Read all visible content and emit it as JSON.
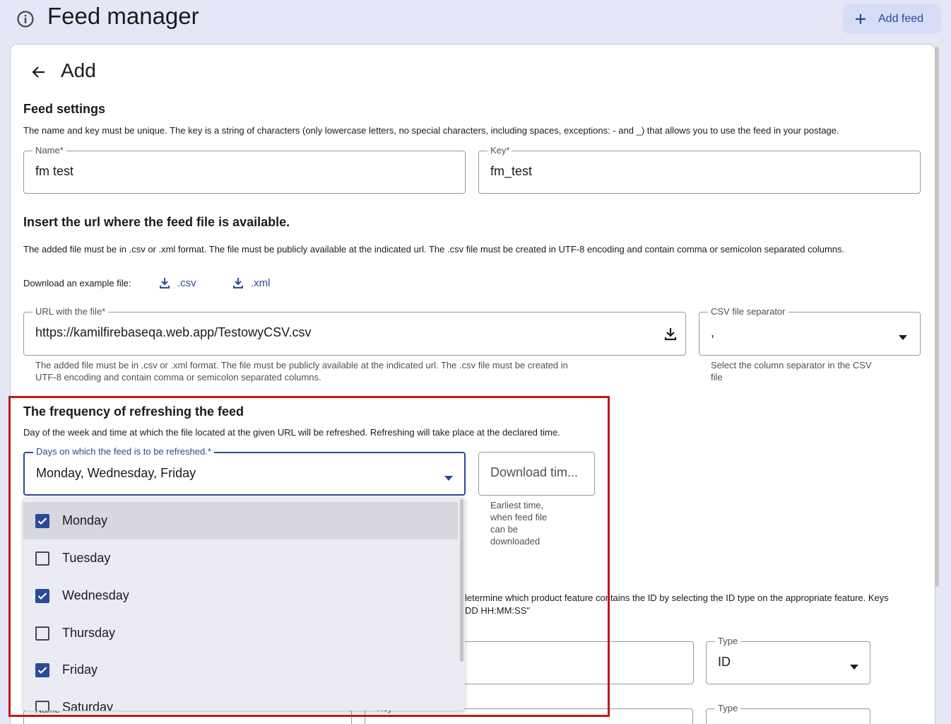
{
  "header": {
    "title": "Feed manager",
    "add_feed_label": "Add feed"
  },
  "card": {
    "title": "Add"
  },
  "feed_settings": {
    "title": "Feed settings",
    "description": "The name and key must be unique. The key is a string of characters (only lowercase letters, no special characters, including spaces, exceptions: - and _) that allows you to use the feed in your postage.",
    "name": {
      "label": "Name",
      "value": "fm test"
    },
    "key": {
      "label": "Key",
      "value": "fm_test"
    }
  },
  "url_section": {
    "title": "Insert the url where the feed file is available.",
    "description": "The added file must be in .csv or .xml format. The file must be publicly available at the indicated url. The .csv file must be created in UTF-8 encoding and contain comma or semicolon separated columns.",
    "example_label": "Download an example file:",
    "example_csv": ".csv",
    "example_xml": ".xml",
    "url_field": {
      "label": "URL with the file",
      "value": "https://kamilfirebaseqa.web.app/TestowyCSV.csv",
      "helper_line1": "The added file must be in .csv or .xml format. The file must be publicly available at the indicated url. The .csv file must be created in",
      "helper_line2": "UTF-8 encoding and contain comma or semicolon separated columns."
    },
    "separator_field": {
      "label": "CSV file separator",
      "value": ",",
      "helper_line1": "Select the column separator in the CSV",
      "helper_line2": "file"
    }
  },
  "frequency": {
    "title": "The frequency of refreshing the feed",
    "description": "Day of the week and time at which the file located at the given URL will be refreshed. Refreshing will take place at the declared time.",
    "days_field": {
      "label": "Days on which the feed is to be refreshed.",
      "value": "Monday, Wednesday, Friday"
    },
    "time_field": {
      "placeholder": "Download tim...",
      "helper": [
        "Earliest time,",
        "when feed file",
        "can be",
        "downloaded"
      ]
    },
    "days_options": [
      {
        "label": "Monday",
        "checked": true
      },
      {
        "label": "Tuesday",
        "checked": false
      },
      {
        "label": "Wednesday",
        "checked": true
      },
      {
        "label": "Thursday",
        "checked": false
      },
      {
        "label": "Friday",
        "checked": true
      },
      {
        "label": "Saturday",
        "checked": false
      }
    ]
  },
  "behind": {
    "text_line1": "letermine which product feature contains the ID by selecting the ID type on the appropriate feature. Keys",
    "text_line2": "DD HH:MM:SS\"",
    "type1": {
      "label": "Type",
      "value": "ID"
    },
    "type2": {
      "label": "Type"
    },
    "name_label": "Name",
    "key_label": "Key"
  },
  "colors": {
    "accent": "#2b4a97",
    "highlight": "#c01818",
    "background": "#e6e7f6"
  }
}
